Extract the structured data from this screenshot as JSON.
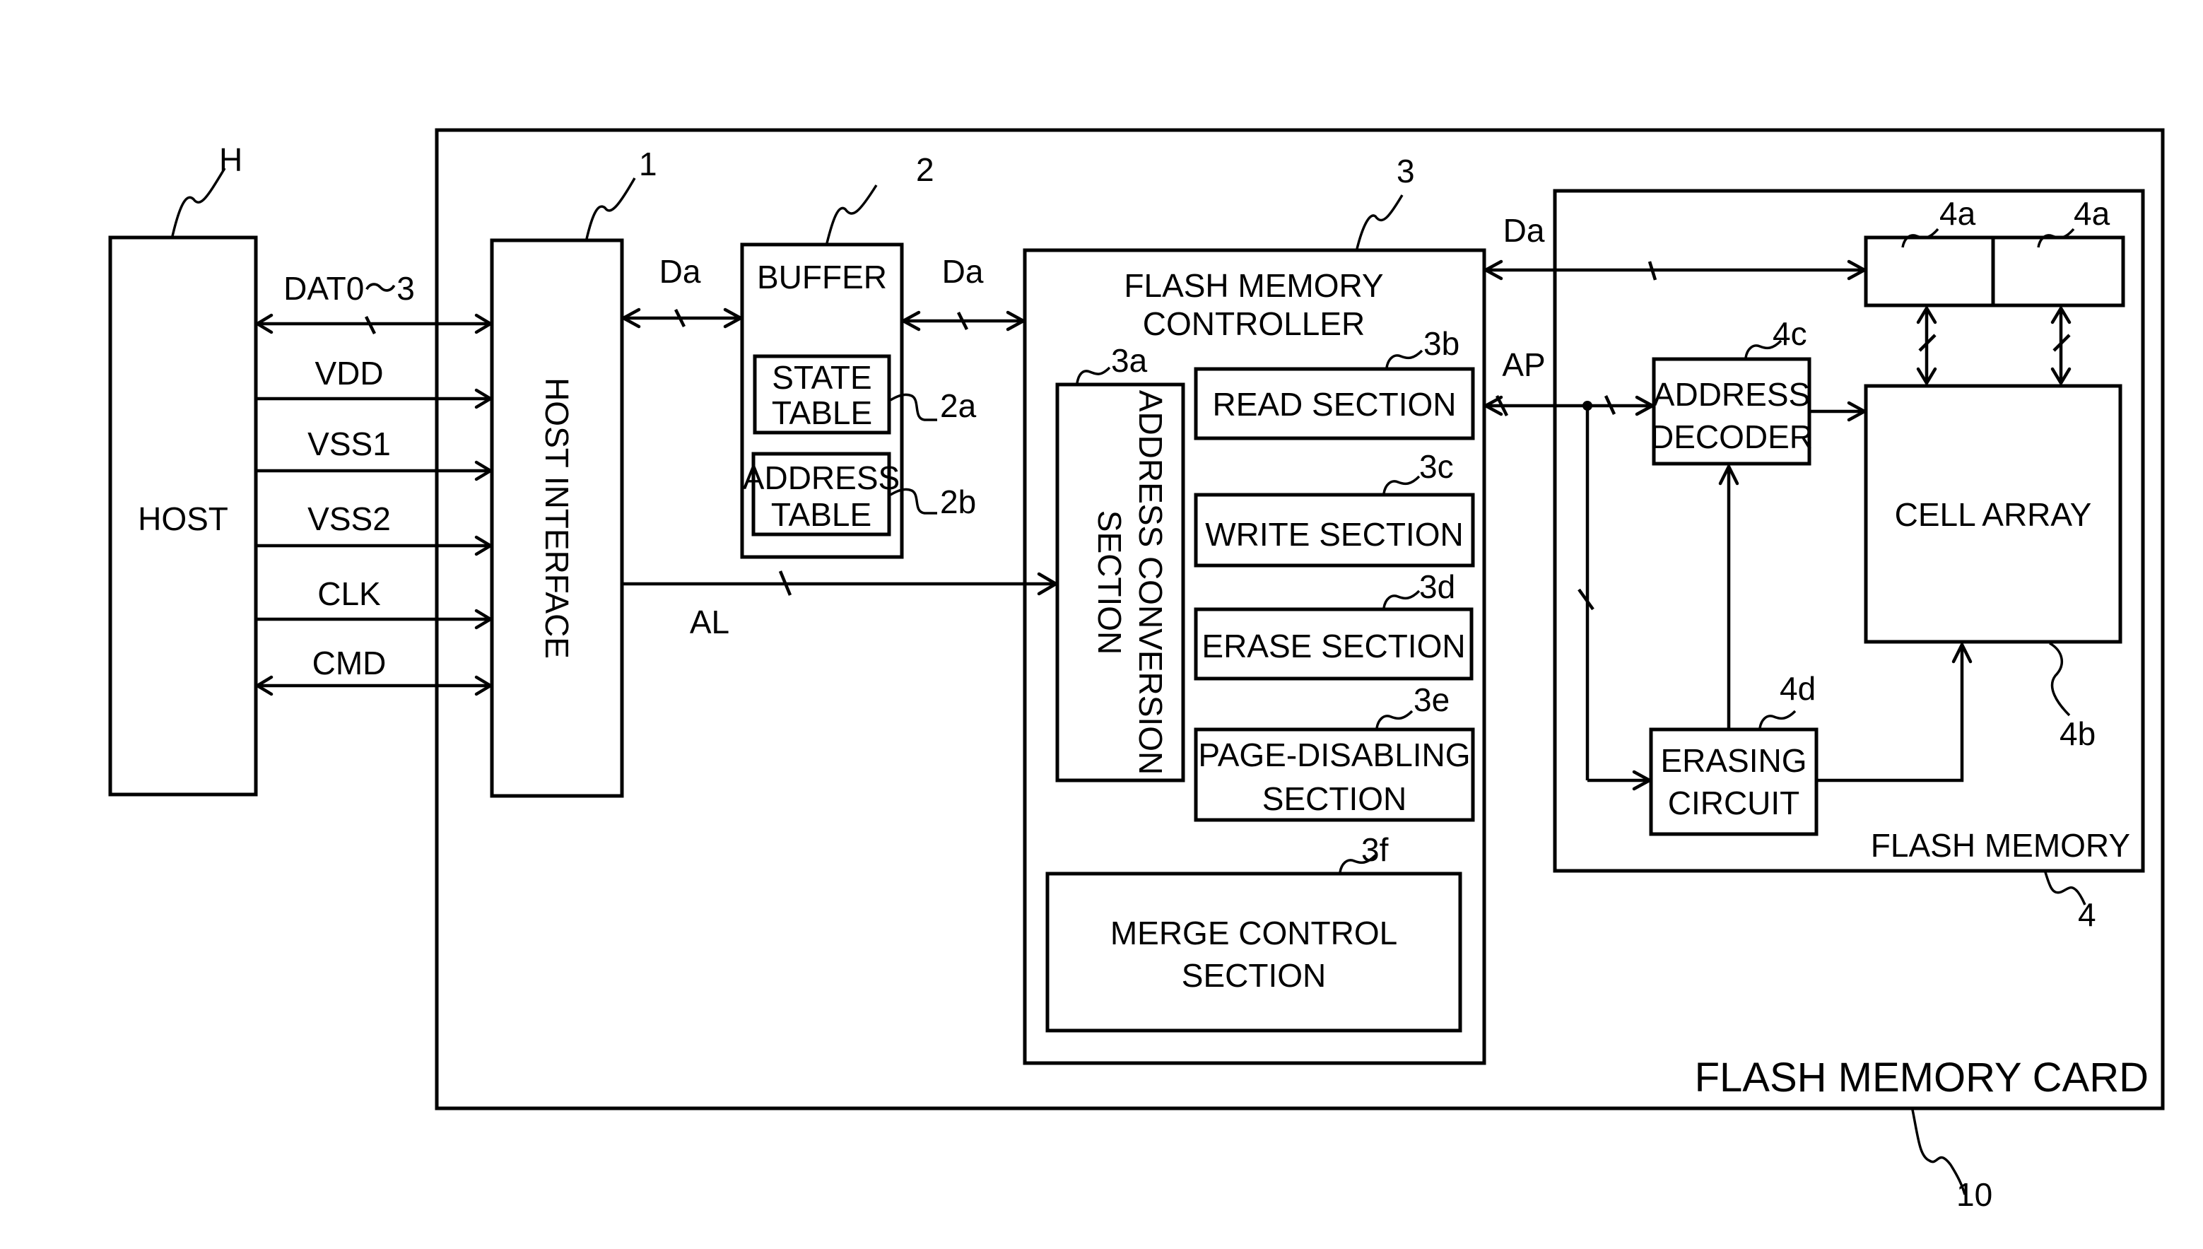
{
  "colors": {
    "ink": "#000000",
    "paper": "#ffffff"
  },
  "host": {
    "label": "HOST",
    "ref": "H"
  },
  "card": {
    "label": "FLASH MEMORY CARD",
    "ref": "10"
  },
  "host_interface": {
    "label": "HOST INTERFACE",
    "ref": "1"
  },
  "buffer": {
    "label": "BUFFER",
    "ref": "2",
    "state_table": {
      "line1": "STATE",
      "line2": "TABLE",
      "ref": "2a"
    },
    "address_table": {
      "line1": "ADDRESS",
      "line2": "TABLE",
      "ref": "2b"
    }
  },
  "controller": {
    "line1": "FLASH MEMORY",
    "line2": "CONTROLLER",
    "ref": "3",
    "address_conversion": {
      "line1": "ADDRESS CONVERSION",
      "line2": "SECTION",
      "ref": "3a"
    },
    "read": {
      "label": "READ SECTION",
      "ref": "3b"
    },
    "write": {
      "label": "WRITE SECTION",
      "ref": "3c"
    },
    "erase": {
      "label": "ERASE SECTION",
      "ref": "3d"
    },
    "page_disabling": {
      "line1": "PAGE-DISABLING",
      "line2": "SECTION",
      "ref": "3e"
    },
    "merge": {
      "line1": "MERGE CONTROL",
      "line2": "SECTION",
      "ref": "3f"
    }
  },
  "flash_memory": {
    "label": "FLASH MEMORY",
    "ref": "4",
    "page_buffer_ref": "4a",
    "cell_array": {
      "label": "CELL ARRAY",
      "ref": "4b"
    },
    "address_decoder": {
      "line1": "ADDRESS",
      "line2": "DECODER",
      "ref": "4c"
    },
    "erasing_circuit": {
      "line1": "ERASING",
      "line2": "CIRCUIT",
      "ref": "4d"
    }
  },
  "signals": {
    "dat": "DAT0～3",
    "vdd": "VDD",
    "vss1": "VSS1",
    "vss2": "VSS2",
    "clk": "CLK",
    "cmd": "CMD",
    "da": "Da",
    "al": "AL",
    "ap": "AP"
  }
}
